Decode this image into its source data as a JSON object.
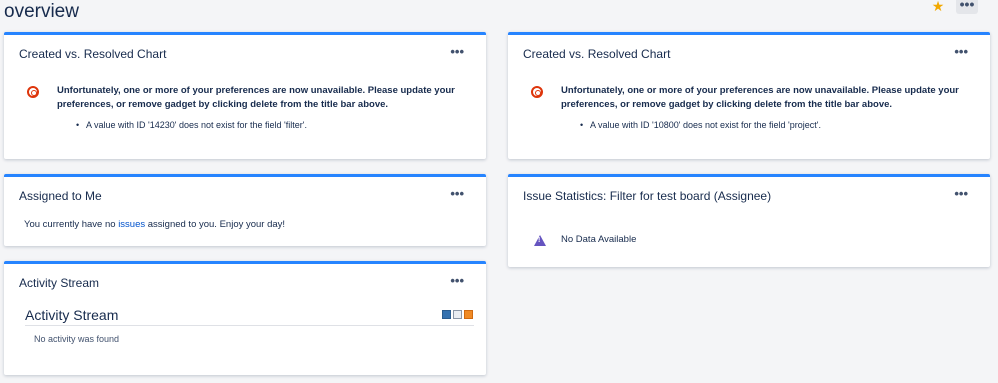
{
  "page": {
    "title": "overview",
    "menu_label": "•••"
  },
  "gadgets": {
    "created_left": {
      "title": "Created vs. Resolved Chart",
      "menu": "•••",
      "error_line1": "Unfortunately, one or more of your preferences are now unavailable. Please update your",
      "error_line2": "preferences, or remove gadget by clicking delete from the title bar above.",
      "detail": "A value with ID '14230' does not exist for the field 'filter'."
    },
    "created_right": {
      "title": "Created vs. Resolved Chart",
      "menu": "•••",
      "error_line1": "Unfortunately, one or more of your preferences are now unavailable. Please update your",
      "error_line2": "preferences, or remove gadget by clicking delete from the title bar above.",
      "detail": "A value with ID '10800' does not exist for the field 'project'."
    },
    "assigned": {
      "title": "Assigned to Me",
      "menu": "•••",
      "text_before": "You currently have no ",
      "link": "issues",
      "text_after": " assigned to you. Enjoy your day!"
    },
    "issue_stats": {
      "title": "Issue Statistics: Filter for test board (Assignee)",
      "menu": "•••",
      "message": "No Data Available"
    },
    "activity": {
      "title": "Activity Stream",
      "menu": "•••",
      "inner_title": "Activity Stream",
      "empty": "No activity was found"
    }
  },
  "colors": {
    "accent": "#2684ff",
    "error": "#de350b",
    "warning": "#6554c0",
    "star": "#f2a900"
  }
}
